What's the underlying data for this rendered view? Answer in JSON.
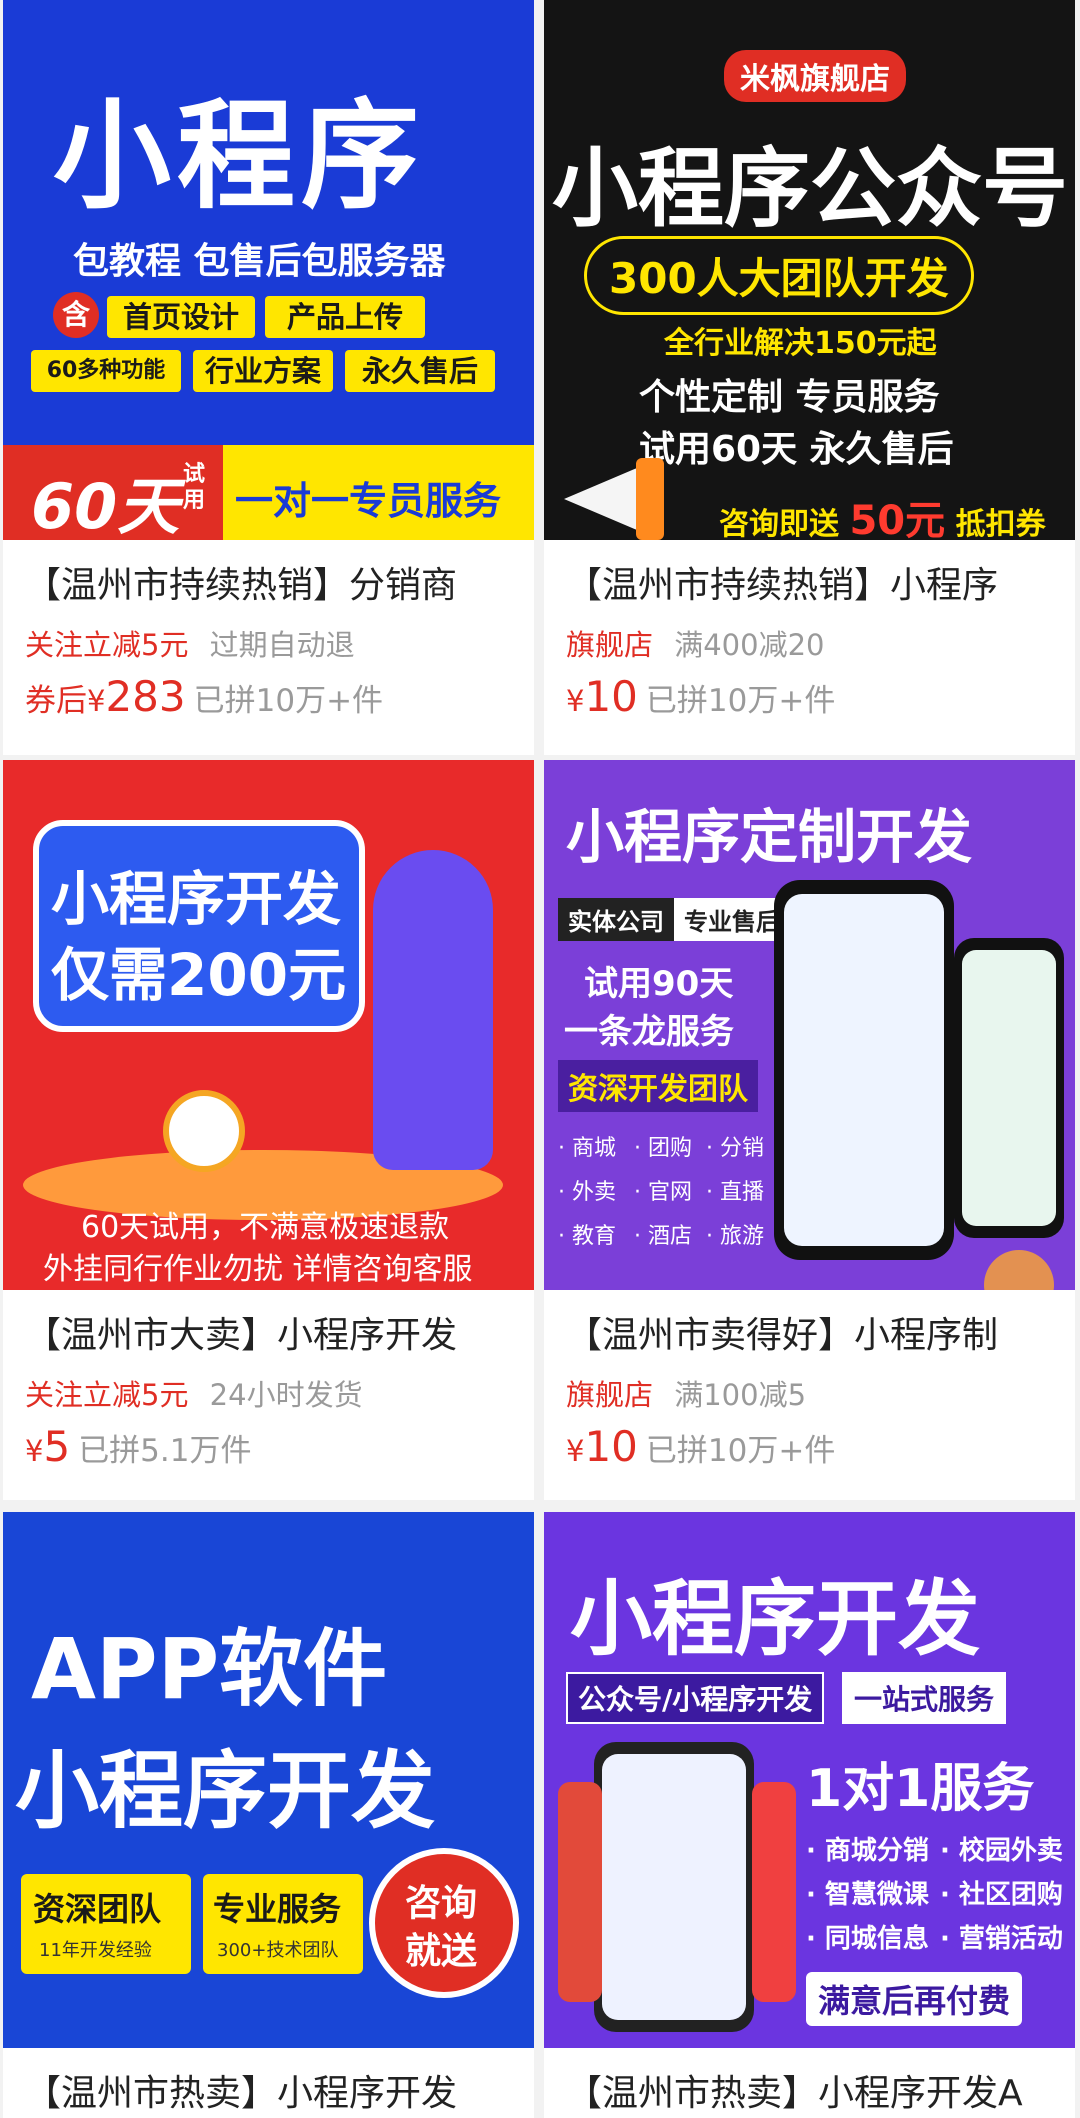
{
  "products": [
    {
      "banner": {
        "headline": "小程序",
        "sub": "包教程 包售后包服务器",
        "badge": "含",
        "tags": [
          "首页设计",
          "产品上传",
          "60多种功能",
          "行业方案",
          "永久售后"
        ],
        "days": "60天",
        "trial": "试用",
        "service": "一对一专员服务"
      },
      "title": "【温州市持续热销】分销商",
      "promo": "关注立减5元",
      "promo_note": "过期自动退",
      "price_prefix": "券后",
      "currency": "¥",
      "price": "283",
      "sold": "已拼10万+件"
    },
    {
      "banner": {
        "store": "米枫旗舰店",
        "headline": "小程序公众号",
        "team": "300人大团队开发",
        "line1": "全行业解决150元起",
        "line2": "个性定制 专员服务",
        "line3": "试用60天 永久售后",
        "consult": "咨询即送",
        "amount": "50元",
        "voucher": "抵扣券"
      },
      "title": "【温州市持续热销】小程序",
      "promo": "旗舰店",
      "promo_note": "满400减20",
      "price_prefix": "",
      "currency": "¥",
      "price": "10",
      "sold": "已拼10万+件"
    },
    {
      "banner": {
        "headline1": "小程序开发",
        "headline2": "仅需200元",
        "note1": "60天试用，不满意极速退款",
        "note2": "外挂同行作业勿扰 详情咨询客服"
      },
      "title": "【温州市大卖】小程序开发",
      "promo": "关注立减5元",
      "promo_note": "24小时发货",
      "price_prefix": "",
      "currency": "¥",
      "price": "5",
      "sold": "已拼5.1万件"
    },
    {
      "banner": {
        "headline": "小程序定制开发",
        "tag1": "实体公司",
        "tag2": "专业售后",
        "trial": "试用90天",
        "service": "一条龙服务",
        "team": "资深开发团队",
        "features": [
          "· 商城",
          "· 团购",
          "· 分销",
          "· 外卖",
          "· 官网",
          "· 直播",
          "· 教育",
          "· 酒店",
          "· 旅游"
        ]
      },
      "title": "【温州市卖得好】小程序制",
      "promo": "旗舰店",
      "promo_note": "满100减5",
      "price_prefix": "",
      "currency": "¥",
      "price": "10",
      "sold": "已拼10万+件"
    },
    {
      "banner": {
        "headline1": "APP软件",
        "headline2": "小程序开发",
        "box1_title": "资深团队",
        "box1_sub": "11年开发经验",
        "box2_title": "专业服务",
        "box2_sub": "300+技术团队",
        "stamp1": "咨询",
        "stamp2": "就送"
      },
      "title": "【温州市热卖】小程序开发"
    },
    {
      "banner": {
        "headline": "小程序开发",
        "tag1": "公众号/小程序开发",
        "tag2": "一站式服务",
        "service": "1对1服务",
        "features": [
          "· 商城分销",
          "· 校园外卖",
          "· 智慧微课",
          "· 社区团购",
          "· 同城信息",
          "· 营销活动"
        ],
        "footer": "满意后再付费"
      },
      "title": "【温州市热卖】小程序开发A"
    }
  ]
}
